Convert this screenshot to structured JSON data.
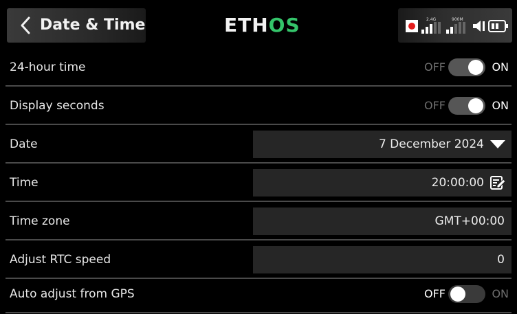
{
  "header": {
    "title": "Date & Time",
    "logo_left": "ETH",
    "logo_right": "OS",
    "signal_1_band": "2.4G",
    "signal_2_band": "900M"
  },
  "settings": [
    {
      "label": "24-hour time",
      "type": "toggle",
      "off_label": "OFF",
      "on_label": "ON",
      "value": true
    },
    {
      "label": "Display seconds",
      "type": "toggle",
      "off_label": "OFF",
      "on_label": "ON",
      "value": true
    },
    {
      "label": "Date",
      "type": "dropdown",
      "value": "7 December 2024"
    },
    {
      "label": "Time",
      "type": "edit",
      "value": "20:00:00"
    },
    {
      "label": "Time zone",
      "type": "field",
      "value": "GMT+00:00"
    },
    {
      "label": "Adjust RTC speed",
      "type": "field",
      "value": "0"
    },
    {
      "label": "Auto adjust from GPS",
      "type": "toggle",
      "off_label": "OFF",
      "on_label": "ON",
      "value": false
    }
  ],
  "colors": {
    "accent_green": "#34c46a",
    "record_red": "#e31c1c",
    "active_text": "#ffffff",
    "inactive_text": "#6e6e6e"
  }
}
